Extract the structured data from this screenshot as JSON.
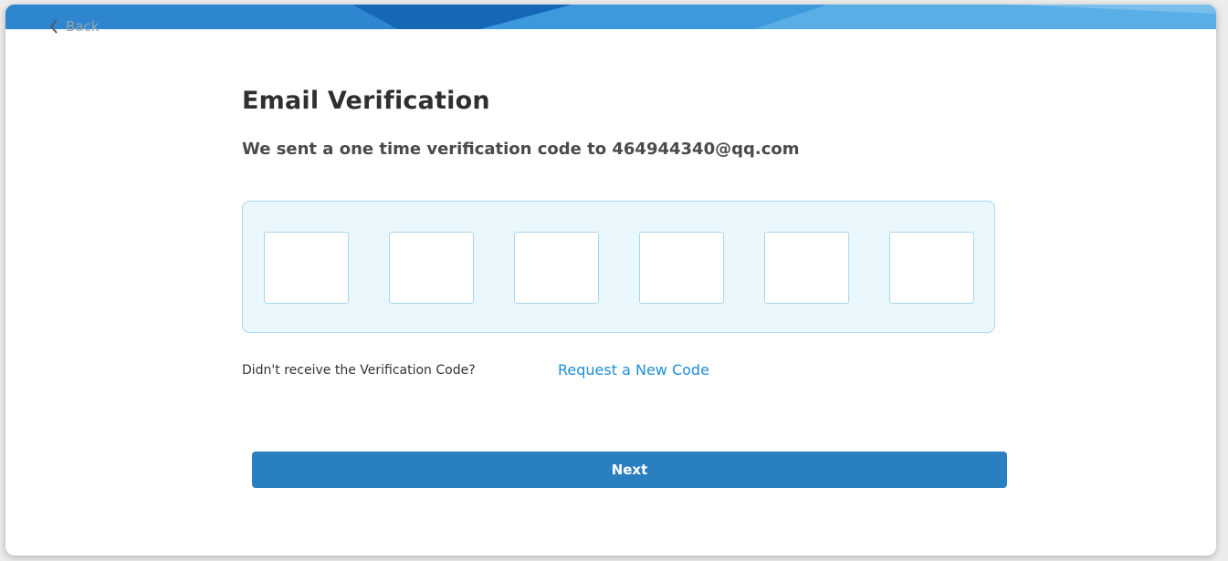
{
  "nav": {
    "back_label": "Back"
  },
  "main": {
    "title": "Email Verification",
    "subtitle": "We sent a one time verification code to 464944340@qq.com",
    "code_digits": [
      "",
      "",
      "",
      "",
      "",
      ""
    ],
    "resend_prompt": "Didn't receive the Verification Code?",
    "resend_link": "Request a New Code",
    "next_label": "Next"
  },
  "colors": {
    "header_band": "#1b73c4",
    "code_box_bg": "#eaf7fd",
    "link": "#1e8fd6",
    "button": "#2a7fc0"
  },
  "icons": {
    "back": "chevron-left-icon"
  }
}
